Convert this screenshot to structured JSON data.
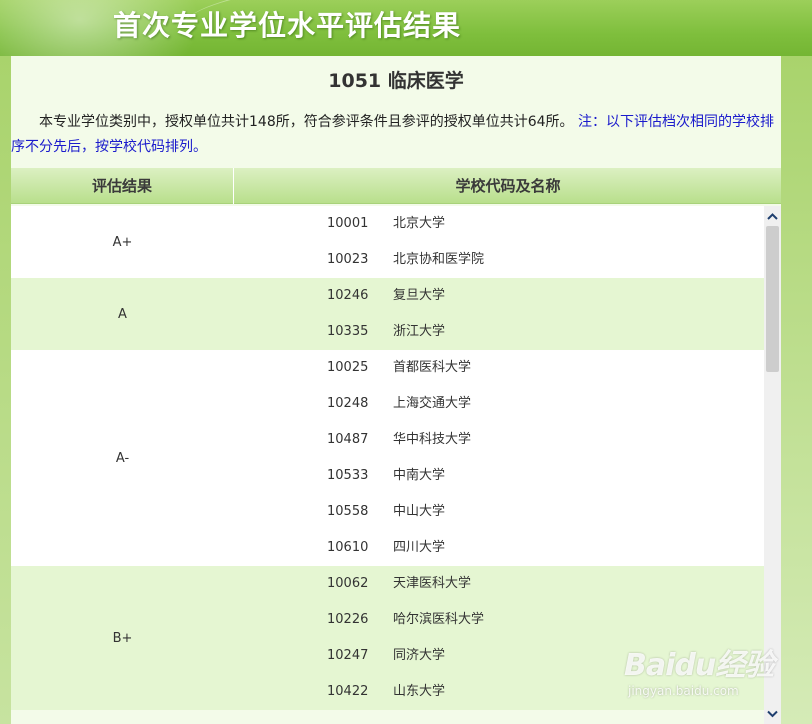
{
  "banner": {
    "title": "首次专业学位水平评估结果"
  },
  "major": {
    "title": "1051  临床医学"
  },
  "intro": {
    "text": "本专业学位类别中，授权单位共计148所，符合参评条件且参评的授权单位共计64所。",
    "note": "注：以下评估档次相同的学校排序不分先后，按学校代码排列。"
  },
  "table": {
    "headers": {
      "grade": "评估结果",
      "school": "学校代码及名称"
    },
    "groups": [
      {
        "grade": "A+",
        "schools": [
          {
            "code": "10001",
            "name": "北京大学"
          },
          {
            "code": "10023",
            "name": "北京协和医学院"
          }
        ]
      },
      {
        "grade": "A",
        "schools": [
          {
            "code": "10246",
            "name": "复旦大学"
          },
          {
            "code": "10335",
            "name": "浙江大学"
          }
        ]
      },
      {
        "grade": "A-",
        "schools": [
          {
            "code": "10025",
            "name": "首都医科大学"
          },
          {
            "code": "10248",
            "name": "上海交通大学"
          },
          {
            "code": "10487",
            "name": "华中科技大学"
          },
          {
            "code": "10533",
            "name": "中南大学"
          },
          {
            "code": "10558",
            "name": "中山大学"
          },
          {
            "code": "10610",
            "name": "四川大学"
          }
        ]
      },
      {
        "grade": "B+",
        "schools": [
          {
            "code": "10062",
            "name": "天津医科大学"
          },
          {
            "code": "10226",
            "name": "哈尔滨医科大学"
          },
          {
            "code": "10247",
            "name": "同济大学"
          },
          {
            "code": "10422",
            "name": "山东大学"
          }
        ]
      }
    ]
  },
  "scrollbar": {
    "up_icon": "chevron-up-icon",
    "down_icon": "chevron-down-icon"
  },
  "watermark": {
    "logo": "Baidu经验",
    "sub": "jingyan.baidu.com"
  },
  "colors": {
    "banner_green": "#7fbf3d",
    "row_green": "#e5f6d2",
    "note_blue": "#1a1acc"
  }
}
